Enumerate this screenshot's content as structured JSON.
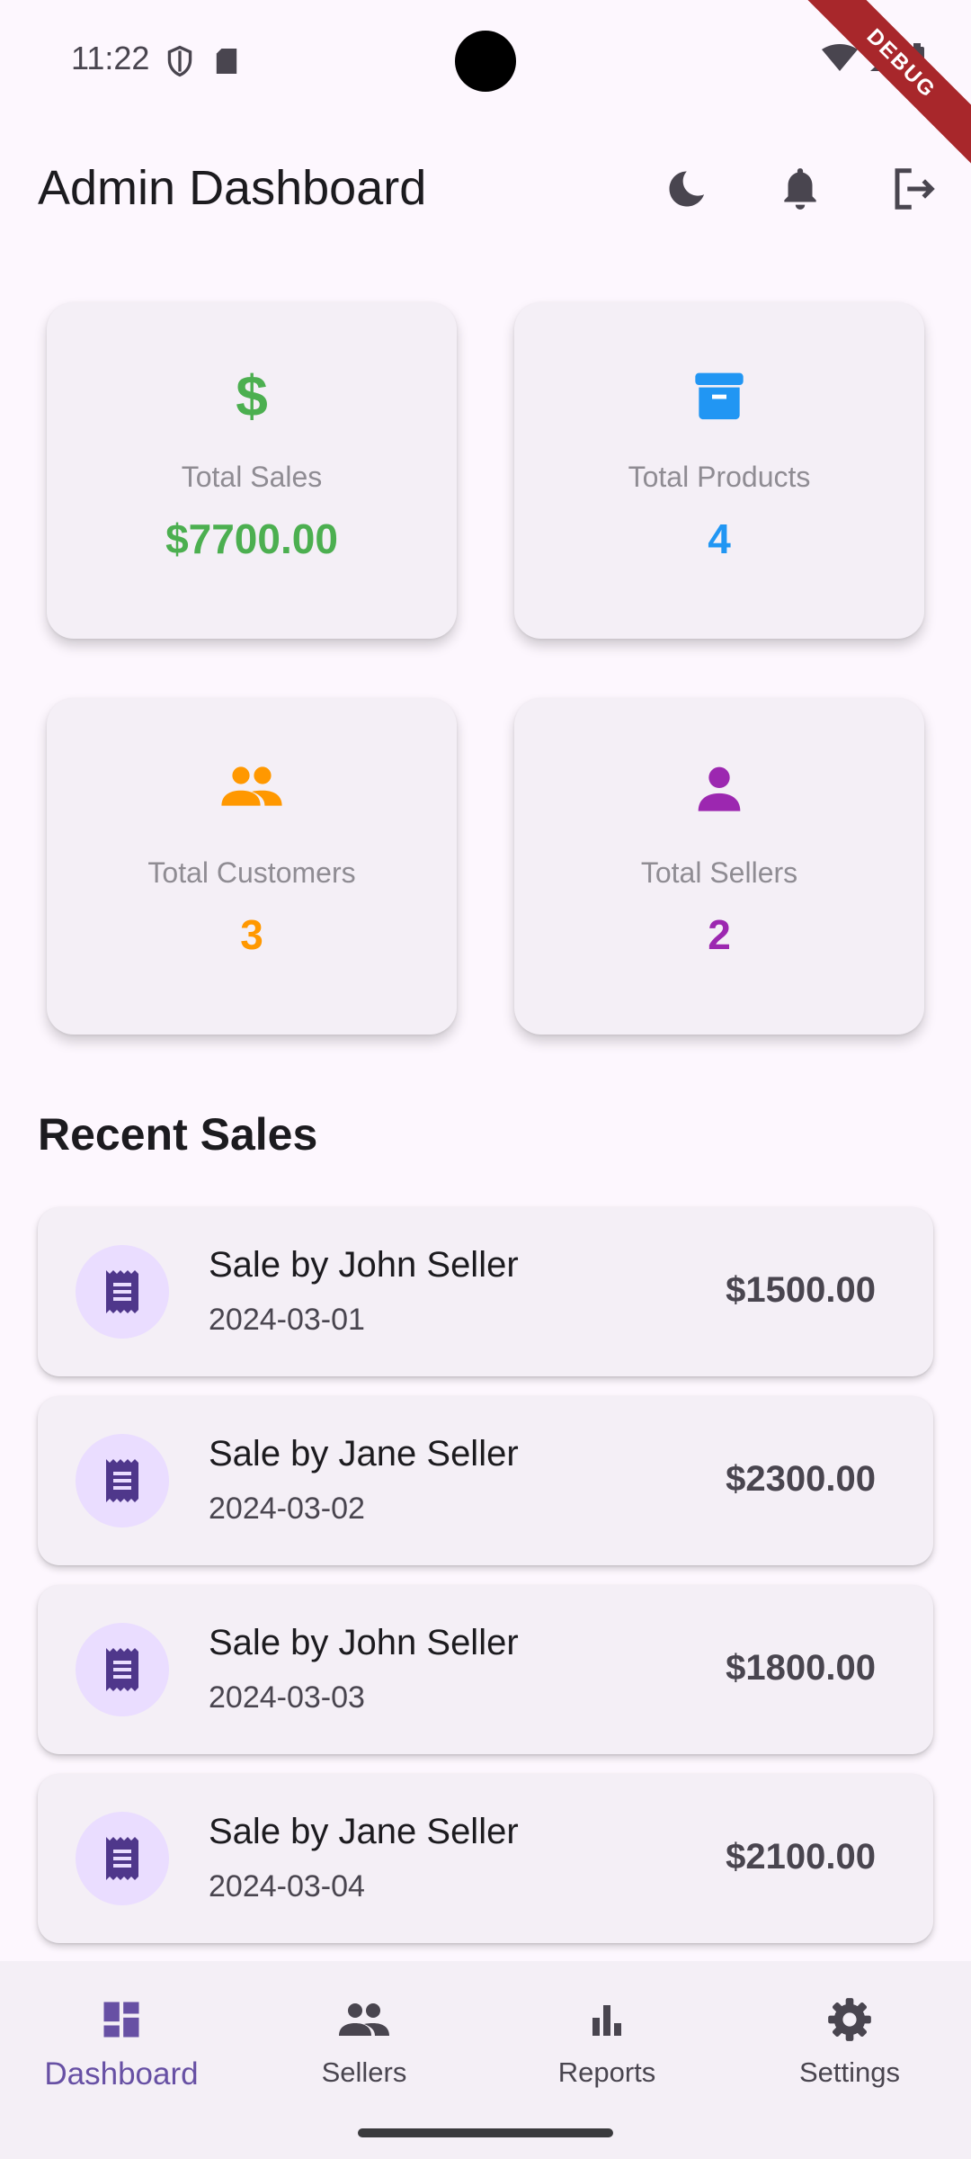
{
  "status_bar": {
    "time": "11:22",
    "debug_label": "DEBUG"
  },
  "app_bar": {
    "title": "Admin Dashboard",
    "actions": [
      "dark-mode-icon",
      "notifications-icon",
      "logout-icon"
    ]
  },
  "stats": [
    {
      "label": "Total Sales",
      "value": "$7700.00",
      "icon": "dollar-icon",
      "color": "#4caf50"
    },
    {
      "label": "Total Products",
      "value": "4",
      "icon": "archive-box-icon",
      "color": "#2196f3"
    },
    {
      "label": "Total Customers",
      "value": "3",
      "icon": "people-icon",
      "color": "#ff9800"
    },
    {
      "label": "Total Sellers",
      "value": "2",
      "icon": "person-icon",
      "color": "#9c27b0"
    }
  ],
  "recent_sales": {
    "title": "Recent Sales",
    "items": [
      {
        "title": "Sale by John Seller",
        "date": "2024-03-01",
        "amount": "$1500.00"
      },
      {
        "title": "Sale by Jane Seller",
        "date": "2024-03-02",
        "amount": "$2300.00"
      },
      {
        "title": "Sale by John Seller",
        "date": "2024-03-03",
        "amount": "$1800.00"
      },
      {
        "title": "Sale by Jane Seller",
        "date": "2024-03-04",
        "amount": "$2100.00"
      }
    ]
  },
  "bottom_nav": {
    "items": [
      {
        "label": "Dashboard",
        "icon": "dashboard-icon",
        "active": true
      },
      {
        "label": "Sellers",
        "icon": "people-icon",
        "active": false
      },
      {
        "label": "Reports",
        "icon": "bar-chart-icon",
        "active": false
      },
      {
        "label": "Settings",
        "icon": "gear-icon",
        "active": false
      }
    ]
  },
  "colors": {
    "primary": "#6750a4",
    "background": "#fdf7fe",
    "card": "#f4eff6",
    "avatar_bg": "#eaddff"
  }
}
